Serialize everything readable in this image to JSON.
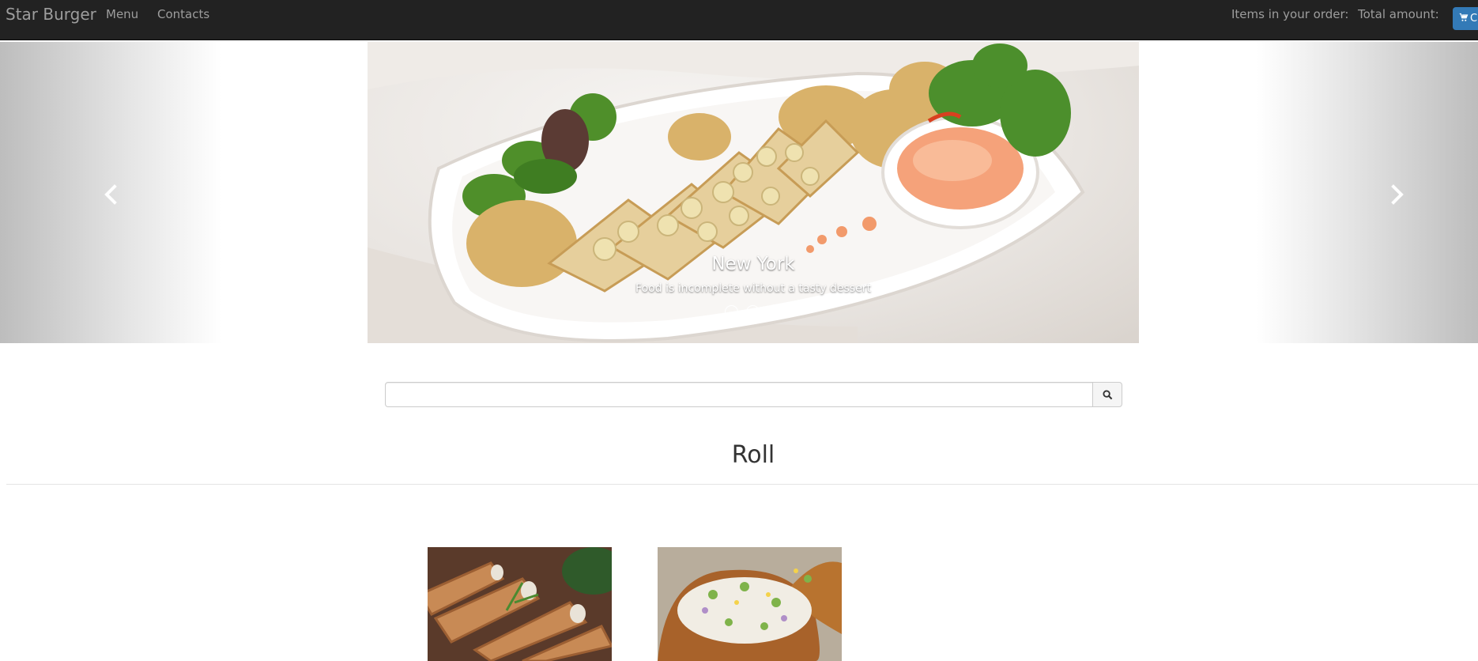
{
  "navbar": {
    "brand": "Star Burger",
    "links": [
      "Menu",
      "Contacts"
    ],
    "order_items_label": "Items in your order:",
    "total_amount_label": "Total amount:",
    "cart_button_label": "C"
  },
  "carousel": {
    "slide_title": "New York",
    "slide_subtitle": "Food is incomplete without a tasty dessert",
    "indicators": 3,
    "active_indicator": 3
  },
  "search": {
    "value": "",
    "placeholder": ""
  },
  "section": {
    "title": "Roll"
  },
  "colors": {
    "navbar_bg": "#222222",
    "navbar_text": "#9d9d9d",
    "cart_button": "#337ab7"
  },
  "icons": [
    "cart-icon",
    "chevron-left-icon",
    "chevron-right-icon",
    "search-icon"
  ]
}
